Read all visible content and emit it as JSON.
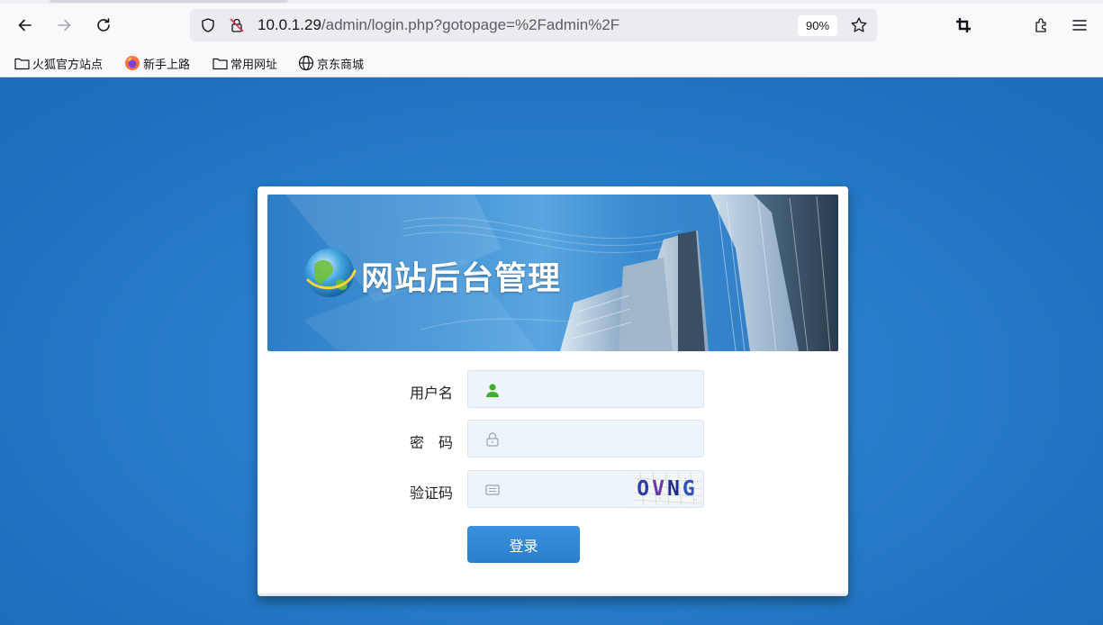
{
  "browser": {
    "url_host": "10.0.1.29",
    "url_path": "/admin/login.php?gotopage=%2Fadmin%2F",
    "zoom": "90%",
    "bookmarks": [
      {
        "label": "火狐官方站点",
        "icon": "folder-icon"
      },
      {
        "label": "新手上路",
        "icon": "firefox-icon"
      },
      {
        "label": "常用网址",
        "icon": "folder-icon"
      },
      {
        "label": "京东商城",
        "icon": "globe-icon"
      }
    ]
  },
  "login": {
    "banner_title": "网站后台管理",
    "username_label": "用户名",
    "password_label": "密　码",
    "captcha_label": "验证码",
    "username_value": "",
    "password_value": "",
    "captcha_value": "",
    "captcha_chars": [
      "O",
      "V",
      "N",
      "G"
    ],
    "captcha_colors": [
      "#2a3fa8",
      "#6b3aa0",
      "#1f2f8a",
      "#2e52b8"
    ],
    "submit_label": "登录"
  }
}
